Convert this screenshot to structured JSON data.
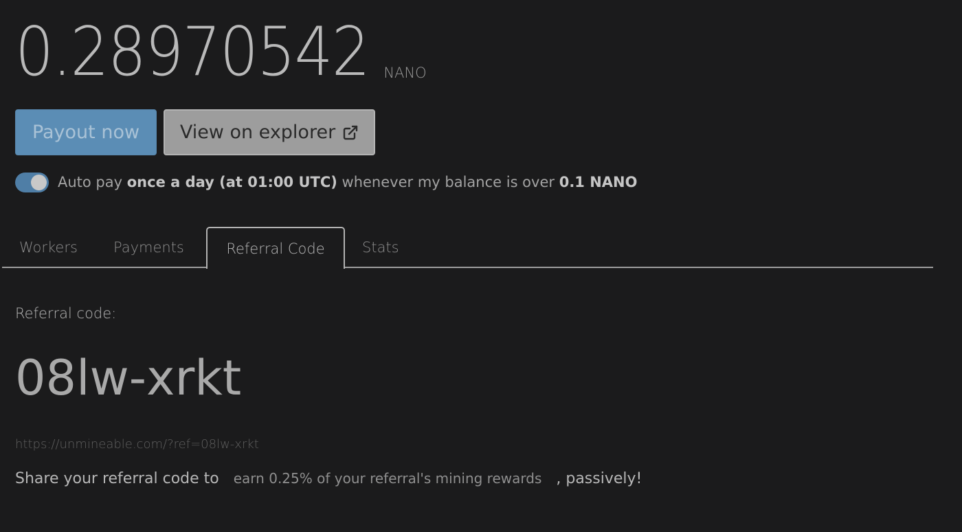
{
  "balance": {
    "amount": "0.28970542",
    "currency": "NANO"
  },
  "buttons": {
    "payout_label": "Payout now",
    "explorer_label": "View on explorer"
  },
  "autopay": {
    "enabled": true,
    "prefix": "Auto pay",
    "frequency": "once a day (at 01:00 UTC)",
    "middle": "whenever my balance is over",
    "threshold": "0.1 NANO"
  },
  "tabs": [
    {
      "label": "Workers",
      "active": false
    },
    {
      "label": "Payments",
      "active": false
    },
    {
      "label": "Referral Code",
      "active": true
    },
    {
      "label": "Stats",
      "active": false
    }
  ],
  "referral": {
    "label": "Referral code:",
    "code": "08lw-xrkt",
    "link": "https://unmineable.com/?ref=08lw-xrkt",
    "share_prefix": "Share your referral code to",
    "share_highlight": "earn 0.25% of your referral's mining rewards",
    "share_suffix": ", passively!"
  },
  "colors": {
    "background": "#1b1b1c",
    "primary_button": "#5b8db5",
    "secondary_button": "#9d9d9d",
    "toggle_on": "#4f7ea6"
  },
  "icons": {
    "explorer_icon": "external-link-icon"
  }
}
